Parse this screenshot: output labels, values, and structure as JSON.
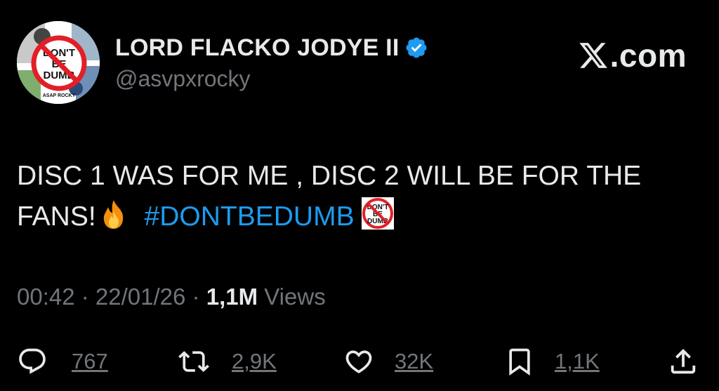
{
  "author": {
    "display_name": "LORD FLACKO JODYE II",
    "handle": "@asvpxrocky",
    "verified": true,
    "avatar_text": [
      "DON'T",
      "BE",
      "DUMB",
      "ASAP ROCKY"
    ]
  },
  "brand": {
    "logo_icon": "x-logo-icon",
    "text": ".com"
  },
  "tweet": {
    "text_line1": "DISC 1 WAS FOR ME , DISC 2 WILL BE FOR THE",
    "text_line2_prefix": "FANS!",
    "emoji": "fire-icon",
    "hashtag": "#DONTBEDUMB",
    "hashtag_emoji_text": [
      "DON'T",
      "BE",
      "DUMB"
    ]
  },
  "meta": {
    "time": "00:42",
    "separator1": " · ",
    "date": "22/01/26",
    "separator2": " · ",
    "views_count": "1,1M",
    "views_label": " Views"
  },
  "actions": {
    "replies": "767",
    "reposts": "2,9K",
    "likes": "32K",
    "bookmarks": "1,1K"
  },
  "colors": {
    "background": "#000000",
    "primary_text": "#e7e9ea",
    "secondary_text": "#71767b",
    "link": "#1d9bf0",
    "verified": "#1d9bf0"
  }
}
